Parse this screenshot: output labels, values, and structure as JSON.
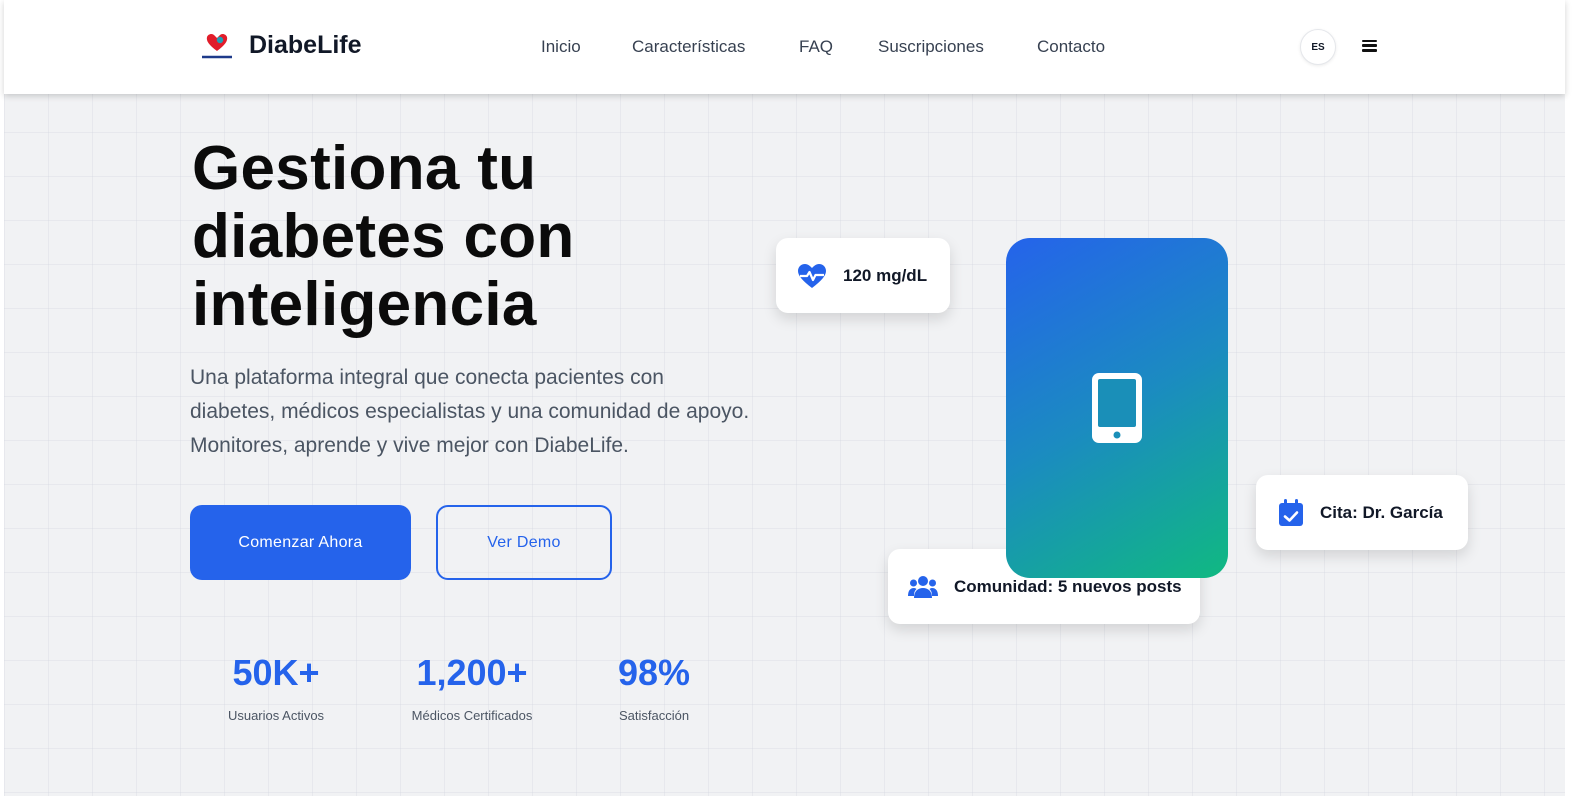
{
  "header": {
    "brand": "DiabeLife",
    "logo_icon": "heart-logo-icon",
    "nav": [
      {
        "label": "Inicio"
      },
      {
        "label": "Características"
      },
      {
        "label": "FAQ"
      },
      {
        "label": "Suscripciones"
      },
      {
        "label": "Contacto"
      }
    ],
    "lang": "ES",
    "menu_icon": "hamburger-menu-icon"
  },
  "hero": {
    "title": "Gestiona tu diabetes con inteligencia",
    "subtitle": "Una plataforma integral que conecta pacientes con diabetes, médicos especialistas y una comunidad de apoyo. Monitores, aprende y vive mejor con DiabeLife.",
    "primary_button": "Comenzar Ahora",
    "secondary_button": "Ver Demo"
  },
  "stats": [
    {
      "value": "50K+",
      "label": "Usuarios Activos"
    },
    {
      "value": "1,200+",
      "label": "Médicos Certificados"
    },
    {
      "value": "98%",
      "label": "Satisfacción"
    }
  ],
  "visual": {
    "glucose_card": {
      "icon": "heartbeat-icon",
      "text": "120 mg/dL"
    },
    "appointment_card": {
      "icon": "calendar-check-icon",
      "text": "Cita: Dr. García"
    },
    "community_card": {
      "icon": "users-icon",
      "text": "Comunidad: 5 nuevos posts"
    },
    "phone_icon": "mobile-phone-icon"
  },
  "colors": {
    "accent": "#2563eb",
    "gradient_end": "#10b981",
    "text_dark": "#0b0b0b",
    "text_muted": "#4b5563"
  }
}
